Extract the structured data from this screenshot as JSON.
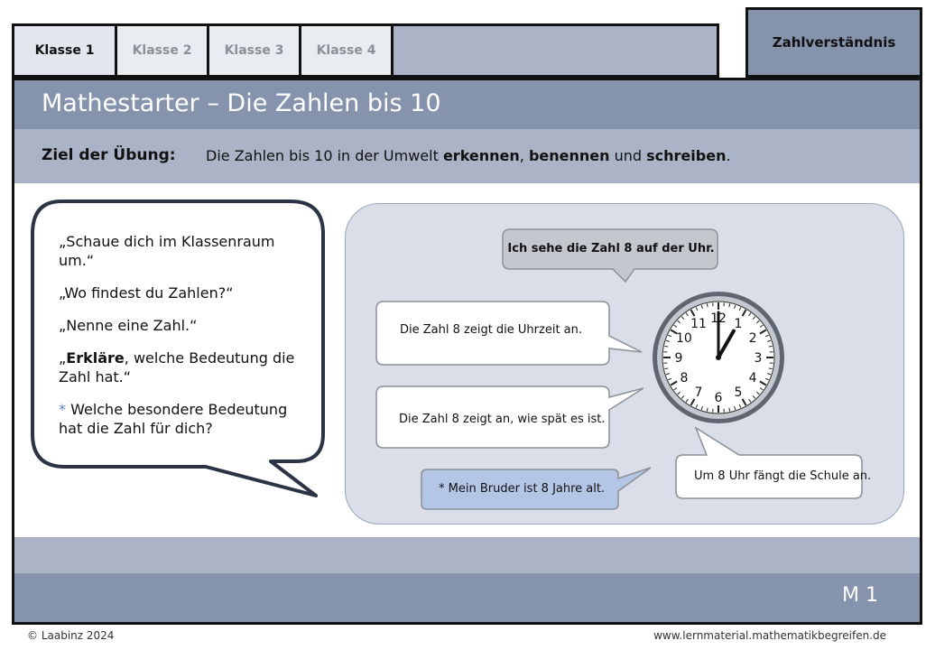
{
  "tabs": [
    {
      "label": "Klasse 1",
      "active": true
    },
    {
      "label": "Klasse 2",
      "active": false
    },
    {
      "label": "Klasse 3",
      "active": false
    },
    {
      "label": "Klasse 4",
      "active": false
    }
  ],
  "topic": "Zahlverständnis",
  "title": "Mathestarter – Die Zahlen bis 10",
  "goal": {
    "label": "Ziel der Übung:",
    "text_1": "Die Zahlen bis 10 in der Umwelt ",
    "bold_1": "erkennen",
    "text_2": ", ",
    "bold_2": "benennen",
    "text_3": " und ",
    "bold_3": "schreiben",
    "text_4": "."
  },
  "prompts": {
    "p1": "„Schaue dich  im Klassenraum um.“",
    "p2": "„Wo findest du Zahlen?“",
    "p3": "„Nenne eine Zahl.“",
    "p4_open": "„",
    "p4_bold": "Erkläre",
    "p4_rest": ", welche Bedeutung die Zahl hat.“",
    "p5_star": "*",
    "p5_text": " Welche besondere Bedeutung hat die Zahl für dich?"
  },
  "speech": {
    "top": "Ich sehe die Zahl 8 auf der Uhr.",
    "a": "Die Zahl 8 zeigt die Uhrzeit an.",
    "b": "Die Zahl 8 zeigt an, wie spät es ist.",
    "c": "* Mein Bruder ist 8 Jahre alt.",
    "d": "Um 8 Uhr fängt die Schule an."
  },
  "clock": {
    "numbers": [
      "12",
      "1",
      "2",
      "3",
      "4",
      "5",
      "6",
      "7",
      "8",
      "9",
      "10",
      "11"
    ],
    "hour": 1,
    "minute": 0
  },
  "code": "M 1",
  "footer": {
    "copyright": "© Laabinz 2024",
    "website": "www.lernmaterial.mathematikbegreifen.de"
  },
  "colors": {
    "dark_band": "#8593ad",
    "light_band": "#aab4c6",
    "scene_bg": "#d9dee9",
    "note_blue": "#b4c6e6"
  }
}
